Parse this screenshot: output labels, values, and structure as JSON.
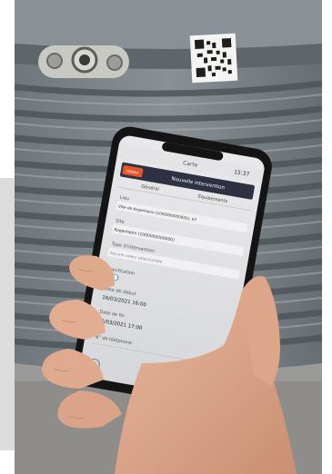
{
  "photo": {
    "description_icon": "bin-photo-icon"
  },
  "phone": {
    "status_time": "15:37",
    "app_title": "Carte",
    "header_badge": "Valider",
    "header_title": "Nouvelle intervention",
    "tab_general": "Général",
    "tab_equipments": "Equipements",
    "field_lieu_label": "Lieu",
    "field_lieu_value": "Ville de Kogenheim (1000000000000), 67",
    "field_site_label": "Site",
    "field_site_value": "Kogenheim (1000000000000)",
    "field_type_label": "Type d'intervention",
    "field_type_value": "Aucune valeur sélectionnée",
    "field_planif_label": "Planification",
    "field_debut_label": "Date de début",
    "field_debut_value": "16/03/2021 16:00",
    "field_fin_label": "Date de fin",
    "field_fin_value": "16/03/2021 17:00",
    "field_tel_label": "N° de téléphone"
  },
  "colors": {
    "accent": "#e8552a",
    "header_dark": "#2d3142",
    "bin": "#7c8388",
    "ground": "#9a9a98"
  }
}
